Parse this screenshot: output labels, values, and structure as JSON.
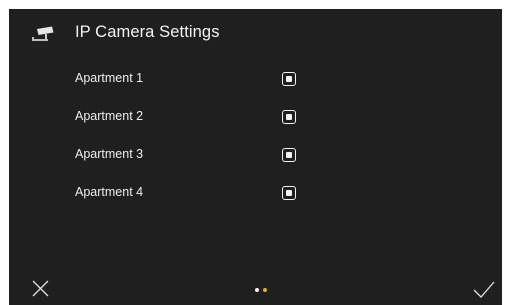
{
  "header": {
    "icon": "ip-camera-icon",
    "title": "IP Camera Settings"
  },
  "apartments": [
    {
      "label": "Apartment 1",
      "checked": true
    },
    {
      "label": "Apartment 2",
      "checked": true
    },
    {
      "label": "Apartment 3",
      "checked": true
    },
    {
      "label": "Apartment 4",
      "checked": true
    }
  ],
  "footer": {
    "cancel_icon": "close-icon",
    "confirm_icon": "checkmark-icon",
    "pager": {
      "pages": 2,
      "current": 2
    }
  },
  "colors": {
    "background": "#1f1f1f",
    "text": "#f2f2f2",
    "pager_inactive": "#f2f2f2",
    "pager_active": "#f5a623"
  }
}
